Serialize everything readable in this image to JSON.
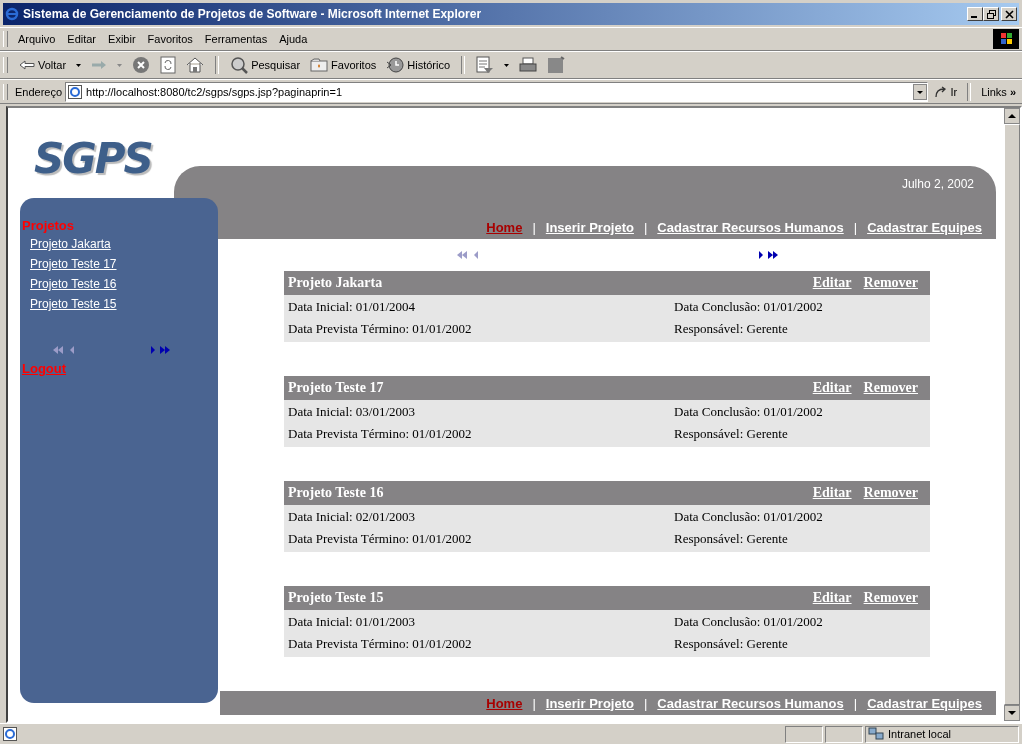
{
  "window": {
    "title": "Sistema de Gerenciamento de Projetos de Software - Microsoft Internet Explorer"
  },
  "menu": [
    "Arquivo",
    "Editar",
    "Exibir",
    "Favoritos",
    "Ferramentas",
    "Ajuda"
  ],
  "toolbar": {
    "back": "Voltar",
    "search": "Pesquisar",
    "favorites": "Favoritos",
    "history": "Histórico"
  },
  "address_bar": {
    "label": "Endereço",
    "url": "http://localhost:8080/tc2/sgps/sgps.jsp?paginaprin=1",
    "go": "Ir",
    "links": "Links",
    "more": "»"
  },
  "page": {
    "logo": "SGPS",
    "date": "Julho 2, 2002",
    "nav_links": [
      {
        "label": "Home",
        "selected": true
      },
      {
        "label": "Inserir Projeto",
        "selected": false
      },
      {
        "label": "Cadastrar Recursos Humanos",
        "selected": false
      },
      {
        "label": "Cadastrar Equipes",
        "selected": false
      }
    ],
    "separator": "|",
    "sidebar": {
      "heading": "Projetos",
      "items": [
        "Projeto Jakarta",
        "Projeto Teste 17",
        "Projeto Teste 16",
        "Projeto Teste 15"
      ],
      "pager": [
        {
          "kind": "first",
          "disabled": true
        },
        {
          "kind": "prev",
          "disabled": true
        },
        {
          "kind": "next",
          "disabled": false
        },
        {
          "kind": "last",
          "disabled": false
        }
      ],
      "logout": "Logout"
    },
    "pager": [
      {
        "kind": "first",
        "disabled": true
      },
      {
        "kind": "prev",
        "disabled": true
      },
      {
        "kind": "next",
        "disabled": false
      },
      {
        "kind": "last",
        "disabled": false
      }
    ],
    "projects": [
      {
        "title": "Projeto Jakarta",
        "actions": [
          "Editar",
          "Remover"
        ],
        "fields": [
          "Data Inicial: 01/01/2004",
          "Data Conclusão: 01/01/2002",
          "Data Prevista Término: 01/01/2002",
          "Responsável: Gerente"
        ]
      },
      {
        "title": "Projeto Teste 17",
        "actions": [
          "Editar",
          "Remover"
        ],
        "fields": [
          "Data Inicial: 03/01/2003",
          "Data Conclusão: 01/01/2002",
          "Data Prevista Término: 01/01/2002",
          "Responsável: Gerente"
        ]
      },
      {
        "title": "Projeto Teste 16",
        "actions": [
          "Editar",
          "Remover"
        ],
        "fields": [
          "Data Inicial: 02/01/2003",
          "Data Conclusão: 01/01/2002",
          "Data Prevista Término: 01/01/2002",
          "Responsável: Gerente"
        ]
      },
      {
        "title": "Projeto Teste 15",
        "actions": [
          "Editar",
          "Remover"
        ],
        "fields": [
          "Data Inicial: 01/01/2003",
          "Data Conclusão: 01/01/2002",
          "Data Prevista Término: 01/01/2002",
          "Responsável: Gerente"
        ]
      }
    ],
    "footer_links": [
      {
        "label": "Home",
        "selected": true
      },
      {
        "label": "Inserir Projeto",
        "selected": false
      },
      {
        "label": "Cadastrar Recursos Humanos",
        "selected": false
      },
      {
        "label": "Cadastrar Equipes",
        "selected": false
      }
    ]
  },
  "status_bar": {
    "zone": "Intranet local"
  }
}
